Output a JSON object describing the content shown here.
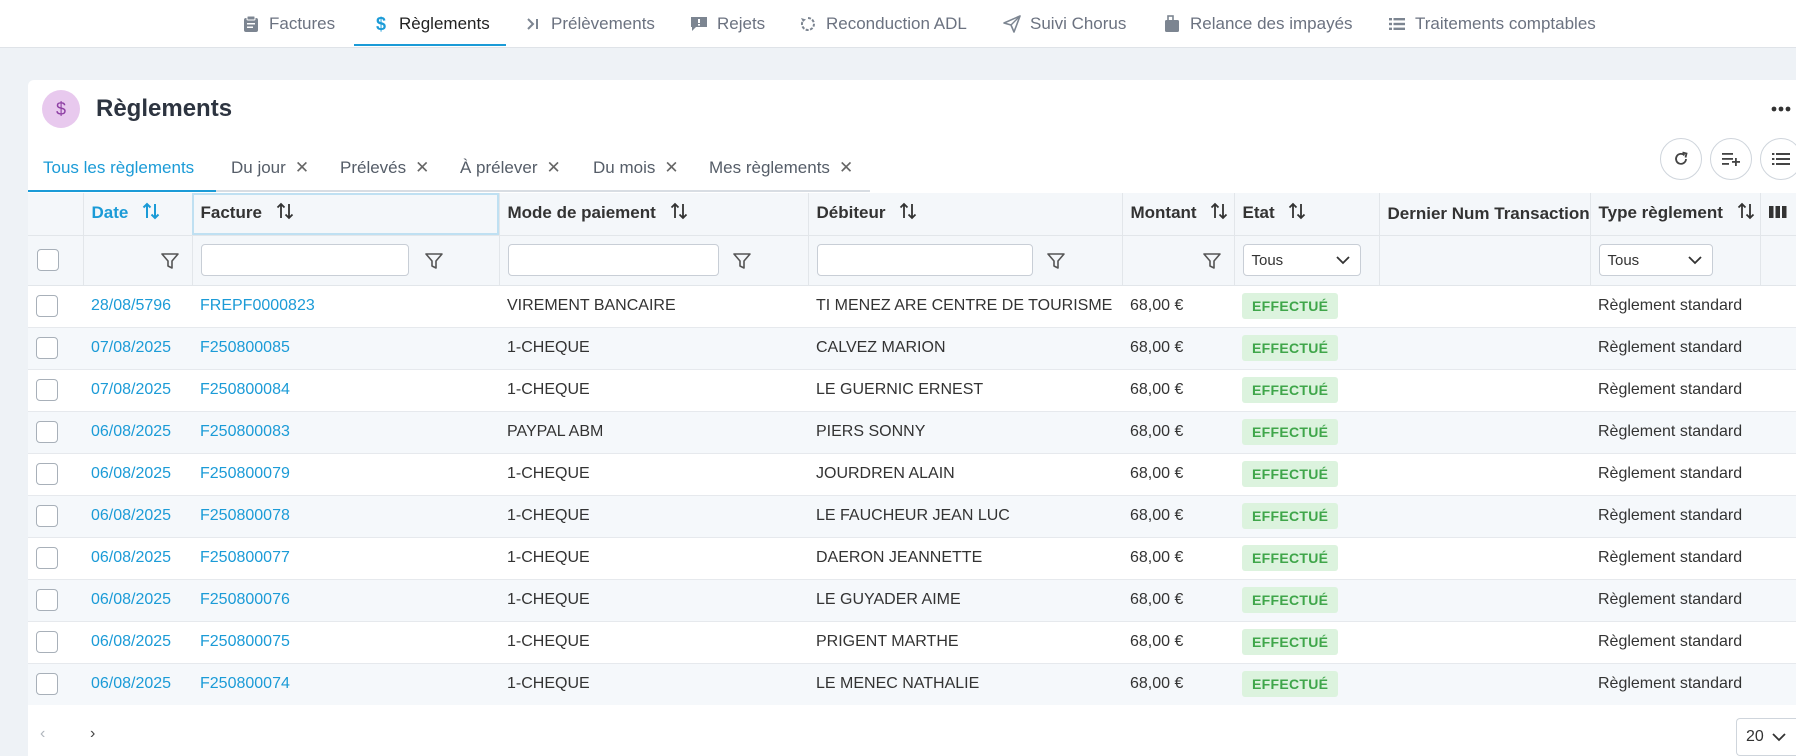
{
  "nav": {
    "items": [
      {
        "label": "Factures",
        "icon": "clipboard-icon"
      },
      {
        "label": "Règlements",
        "icon": "dollar-icon"
      },
      {
        "label": "Prélèvements",
        "icon": "chevron-bar-right-icon"
      },
      {
        "label": "Rejets",
        "icon": "message-alert-icon"
      },
      {
        "label": "Reconduction ADL",
        "icon": "rotate-icon"
      },
      {
        "label": "Suivi Chorus",
        "icon": "paper-plane-icon"
      },
      {
        "label": "Relance des impayés",
        "icon": "briefcase-icon"
      },
      {
        "label": "Traitements comptables",
        "icon": "list-icon"
      }
    ],
    "active_index": 1
  },
  "header": {
    "title": "Règlements",
    "icon": "dollar-icon",
    "icon_glyph": "$"
  },
  "tabs": [
    {
      "label": "Tous les règlements",
      "active": true,
      "closable": false
    },
    {
      "label": "Du jour",
      "active": false,
      "closable": true
    },
    {
      "label": "Prélevés",
      "active": false,
      "closable": true
    },
    {
      "label": "À prélever",
      "active": false,
      "closable": true
    },
    {
      "label": "Du mois",
      "active": false,
      "closable": true
    },
    {
      "label": "Mes règlements",
      "active": false,
      "closable": true
    }
  ],
  "close_glyph": "✕",
  "columns": [
    {
      "label": "Date",
      "sortable": true,
      "sorted": true
    },
    {
      "label": "Facture",
      "sortable": true,
      "sorted": false
    },
    {
      "label": "Mode de paiement",
      "sortable": true,
      "sorted": false
    },
    {
      "label": "Débiteur",
      "sortable": true,
      "sorted": false
    },
    {
      "label": "Montant",
      "sortable": true,
      "sorted": false
    },
    {
      "label": "Etat",
      "sortable": true,
      "sorted": false
    },
    {
      "label": "Dernier Num Transaction",
      "sortable": false,
      "sorted": false
    },
    {
      "label": "Type règlement",
      "sortable": true,
      "sorted": false
    }
  ],
  "filters": {
    "facture_value": "",
    "mode_value": "",
    "debiteur_value": "",
    "etat_selected": "Tous",
    "type_selected": "Tous"
  },
  "rows": [
    {
      "date": "28/08/5796",
      "facture": "FREPF0000823",
      "mode": "VIREMENT BANCAIRE",
      "debiteur": "TI MENEZ ARE CENTRE DE TOURISME",
      "montant": "68,00 €",
      "etat": "EFFECTUÉ",
      "num": "",
      "type": "Règlement standard"
    },
    {
      "date": "07/08/2025",
      "facture": "F250800085",
      "mode": "1-CHEQUE",
      "debiteur": "CALVEZ MARION",
      "montant": "68,00 €",
      "etat": "EFFECTUÉ",
      "num": "",
      "type": "Règlement standard"
    },
    {
      "date": "07/08/2025",
      "facture": "F250800084",
      "mode": "1-CHEQUE",
      "debiteur": "LE GUERNIC ERNEST",
      "montant": "68,00 €",
      "etat": "EFFECTUÉ",
      "num": "",
      "type": "Règlement standard"
    },
    {
      "date": "06/08/2025",
      "facture": "F250800083",
      "mode": "PAYPAL ABM",
      "debiteur": "PIERS SONNY",
      "montant": "68,00 €",
      "etat": "EFFECTUÉ",
      "num": "",
      "type": "Règlement standard"
    },
    {
      "date": "06/08/2025",
      "facture": "F250800079",
      "mode": "1-CHEQUE",
      "debiteur": "JOURDREN ALAIN",
      "montant": "68,00 €",
      "etat": "EFFECTUÉ",
      "num": "",
      "type": "Règlement standard"
    },
    {
      "date": "06/08/2025",
      "facture": "F250800078",
      "mode": "1-CHEQUE",
      "debiteur": "LE FAUCHEUR JEAN LUC",
      "montant": "68,00 €",
      "etat": "EFFECTUÉ",
      "num": "",
      "type": "Règlement standard"
    },
    {
      "date": "06/08/2025",
      "facture": "F250800077",
      "mode": "1-CHEQUE",
      "debiteur": "DAERON JEANNETTE",
      "montant": "68,00 €",
      "etat": "EFFECTUÉ",
      "num": "",
      "type": "Règlement standard"
    },
    {
      "date": "06/08/2025",
      "facture": "F250800076",
      "mode": "1-CHEQUE",
      "debiteur": "LE GUYADER AIME",
      "montant": "68,00 €",
      "etat": "EFFECTUÉ",
      "num": "",
      "type": "Règlement standard"
    },
    {
      "date": "06/08/2025",
      "facture": "F250800075",
      "mode": "1-CHEQUE",
      "debiteur": "PRIGENT MARTHE",
      "montant": "68,00 €",
      "etat": "EFFECTUÉ",
      "num": "",
      "type": "Règlement standard"
    },
    {
      "date": "06/08/2025",
      "facture": "F250800074",
      "mode": "1-CHEQUE",
      "debiteur": "LE MENEC NATHALIE",
      "montant": "68,00 €",
      "etat": "EFFECTUÉ",
      "num": "",
      "type": "Règlement standard"
    }
  ],
  "pagination": {
    "prev_glyph": "‹",
    "next_glyph": "›",
    "page_size": "20"
  },
  "colors": {
    "accent": "#1b9bd7",
    "success_bg": "#dcf3de",
    "success_text": "#3fa64a",
    "title_icon_bg": "#e8c9ee"
  }
}
